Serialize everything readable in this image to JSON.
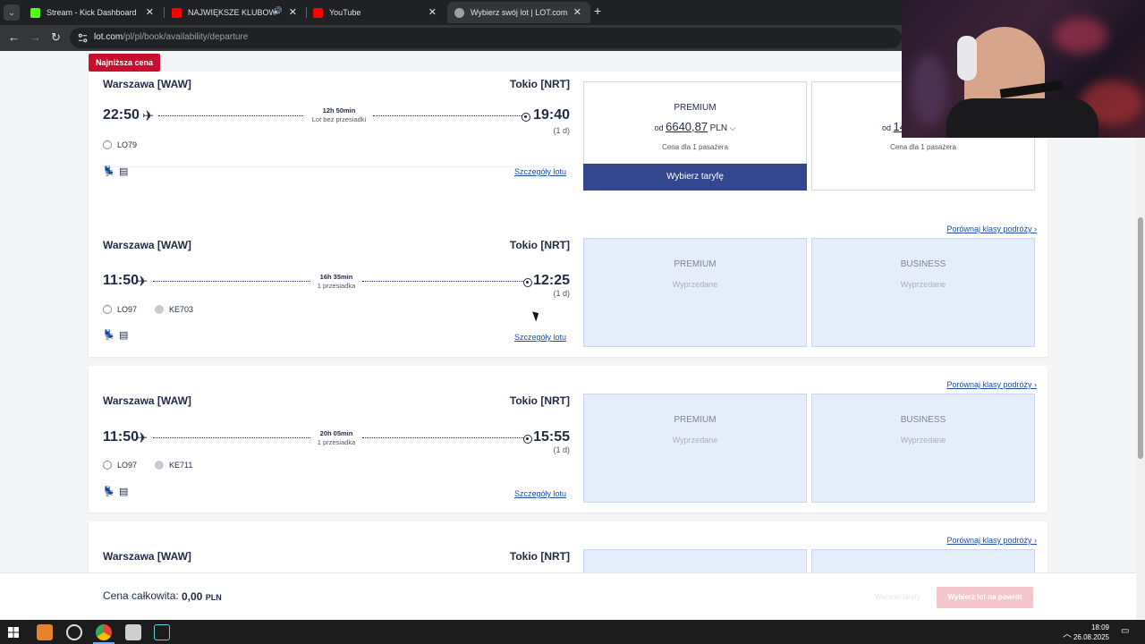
{
  "browser": {
    "tabs": [
      {
        "label": "Stream - Kick Dashboard",
        "favicon_color": "#53fc18"
      },
      {
        "label": "NAJWIĘKSZE KLUBOWE HI",
        "favicon_color": "#ff0000"
      },
      {
        "label": "YouTube",
        "favicon_color": "#ff0000"
      },
      {
        "label": "Wybierz swój lot | LOT.com",
        "favicon_color": "#9aa0a6"
      }
    ],
    "url_host": "lot.com",
    "url_path": "/pl/pl/book/availability/departure"
  },
  "page": {
    "badge": "Najniższa cena",
    "flights": [
      {
        "from": "Warszawa [WAW]",
        "to": "Tokio [NRT]",
        "dep": "22:50",
        "arr": "19:40",
        "plusday": "(1 d)",
        "duration": "12h 50min",
        "stops": "Lot bez przesiadki",
        "flight_numbers": [
          "LO79"
        ],
        "details": "Szczegóły lotu",
        "compare": "",
        "premium": {
          "cls": "PREMIUM",
          "from": "od",
          "amount": "6640,87",
          "currency": "PLN",
          "pax": "Cena dla 1 pasażera",
          "select": "Wybierz taryfę"
        },
        "business": {
          "from": "od",
          "amount_partial": "14",
          "pax": "Cena dla 1 pasażera"
        }
      },
      {
        "from": "Warszawa [WAW]",
        "to": "Tokio [NRT]",
        "dep": "11:50",
        "arr": "12:25",
        "plusday": "(1 d)",
        "duration": "16h 35min",
        "stops": "1 przesiadka",
        "flight_numbers": [
          "LO97",
          "KE703"
        ],
        "details": "Szczegóły lotu",
        "compare": "Porównaj klasy podróży",
        "premium": {
          "cls": "PREMIUM",
          "status": "Wyprzedane"
        },
        "business": {
          "cls": "BUSINESS",
          "status": "Wyprzedane"
        }
      },
      {
        "from": "Warszawa [WAW]",
        "to": "Tokio [NRT]",
        "dep": "11:50",
        "arr": "15:55",
        "plusday": "(1 d)",
        "duration": "20h 05min",
        "stops": "1 przesiadka",
        "flight_numbers": [
          "LO97",
          "KE711"
        ],
        "details": "Szczegóły lotu",
        "compare": "Porównaj klasy podróży",
        "premium": {
          "cls": "PREMIUM",
          "status": "Wyprzedane"
        },
        "business": {
          "cls": "BUSINESS",
          "status": "Wyprzedane"
        }
      },
      {
        "from": "Warszawa [WAW]",
        "to": "Tokio [NRT]",
        "compare": "Porównaj klasy podróży"
      }
    ]
  },
  "footer": {
    "total_label": "Cena całkowita:",
    "total_value": "0,00",
    "total_currency": "PLN",
    "terms": "Warunki taryfy",
    "return_button": "Wybierz lot na powrót"
  },
  "taskbar": {
    "time": "18:09",
    "date": "26.08.2025"
  },
  "colors": {
    "brand_blue": "#33478f",
    "badge_red": "#c8102e",
    "link": "#1d4fa3",
    "sold_bg": "#e6edfa"
  }
}
